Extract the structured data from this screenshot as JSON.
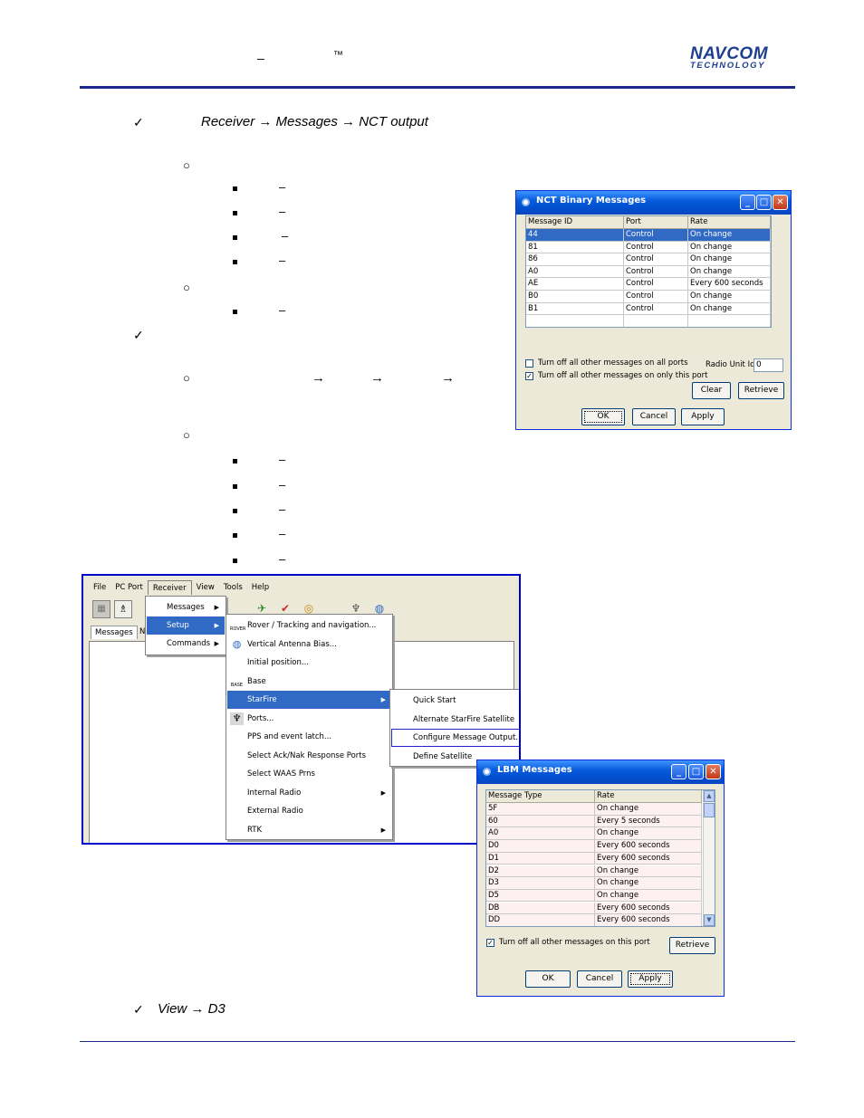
{
  "header": {
    "dash": "–",
    "tm": "™",
    "logo_line1": "NAVCOM",
    "logo_line2": "TECHNOLOGY"
  },
  "text": {
    "path1": "Receiver → Messages → NCT output",
    "path2": "View → D3",
    "dash": "–",
    "arrow": "→"
  },
  "nct": {
    "title": "NCT Binary Messages",
    "columns": [
      "Message ID",
      "Port",
      "Rate"
    ],
    "rows": [
      [
        "44",
        "Control",
        "On change"
      ],
      [
        "81",
        "Control",
        "On change"
      ],
      [
        "86",
        "Control",
        "On change"
      ],
      [
        "A0",
        "Control",
        "On change"
      ],
      [
        "AE",
        "Control",
        "Every 600 seconds"
      ],
      [
        "B0",
        "Control",
        "On change"
      ],
      [
        "B1",
        "Control",
        "On change"
      ]
    ],
    "chk_all_ports": "Turn off all other messages on all ports",
    "chk_this_port": "Turn off all other messages on only this port",
    "radio_label": "Radio Unit Id:",
    "radio_value": "0",
    "clear": "Clear",
    "retrieve": "Retrieve",
    "ok": "OK",
    "cancel": "Cancel",
    "apply": "Apply"
  },
  "menu": {
    "menubar": [
      "File",
      "PC Port",
      "Receiver",
      "View",
      "Tools",
      "Help"
    ],
    "tab_messages": "Messages",
    "tab_n": "N",
    "receiver_items": [
      "Messages",
      "Setup",
      "Commands"
    ],
    "setup_items": [
      "Rover / Tracking and navigation...",
      "Vertical Antenna Bias...",
      "Initial position...",
      "Base",
      "StarFire",
      "Ports...",
      "PPS and event latch...",
      "Select Ack/Nak Response Ports",
      "Select WAAS Prns",
      "Internal Radio",
      "External Radio",
      "RTK"
    ],
    "icon_rover": "ROVER",
    "icon_base": "BASE",
    "starfire_items": [
      "Quick Start",
      "Alternate StarFire Satellite",
      "Configure Message Output...",
      "Define Satellite"
    ]
  },
  "lbm": {
    "title": "LBM Messages",
    "columns": [
      "Message Type",
      "Rate"
    ],
    "rows": [
      [
        "5F",
        "On change"
      ],
      [
        "60",
        "Every 5 seconds"
      ],
      [
        "A0",
        "On change"
      ],
      [
        "D0",
        "Every 600 seconds"
      ],
      [
        "D1",
        "Every 600 seconds"
      ],
      [
        "D2",
        "On change"
      ],
      [
        "D3",
        "On change"
      ],
      [
        "D5",
        "On change"
      ],
      [
        "DB",
        "Every 600 seconds"
      ],
      [
        "DD",
        "Every 600 seconds"
      ]
    ],
    "chk_this_port": "Turn off all other messages on this port",
    "retrieve": "Retrieve",
    "ok": "OK",
    "cancel": "Cancel",
    "apply": "Apply"
  }
}
